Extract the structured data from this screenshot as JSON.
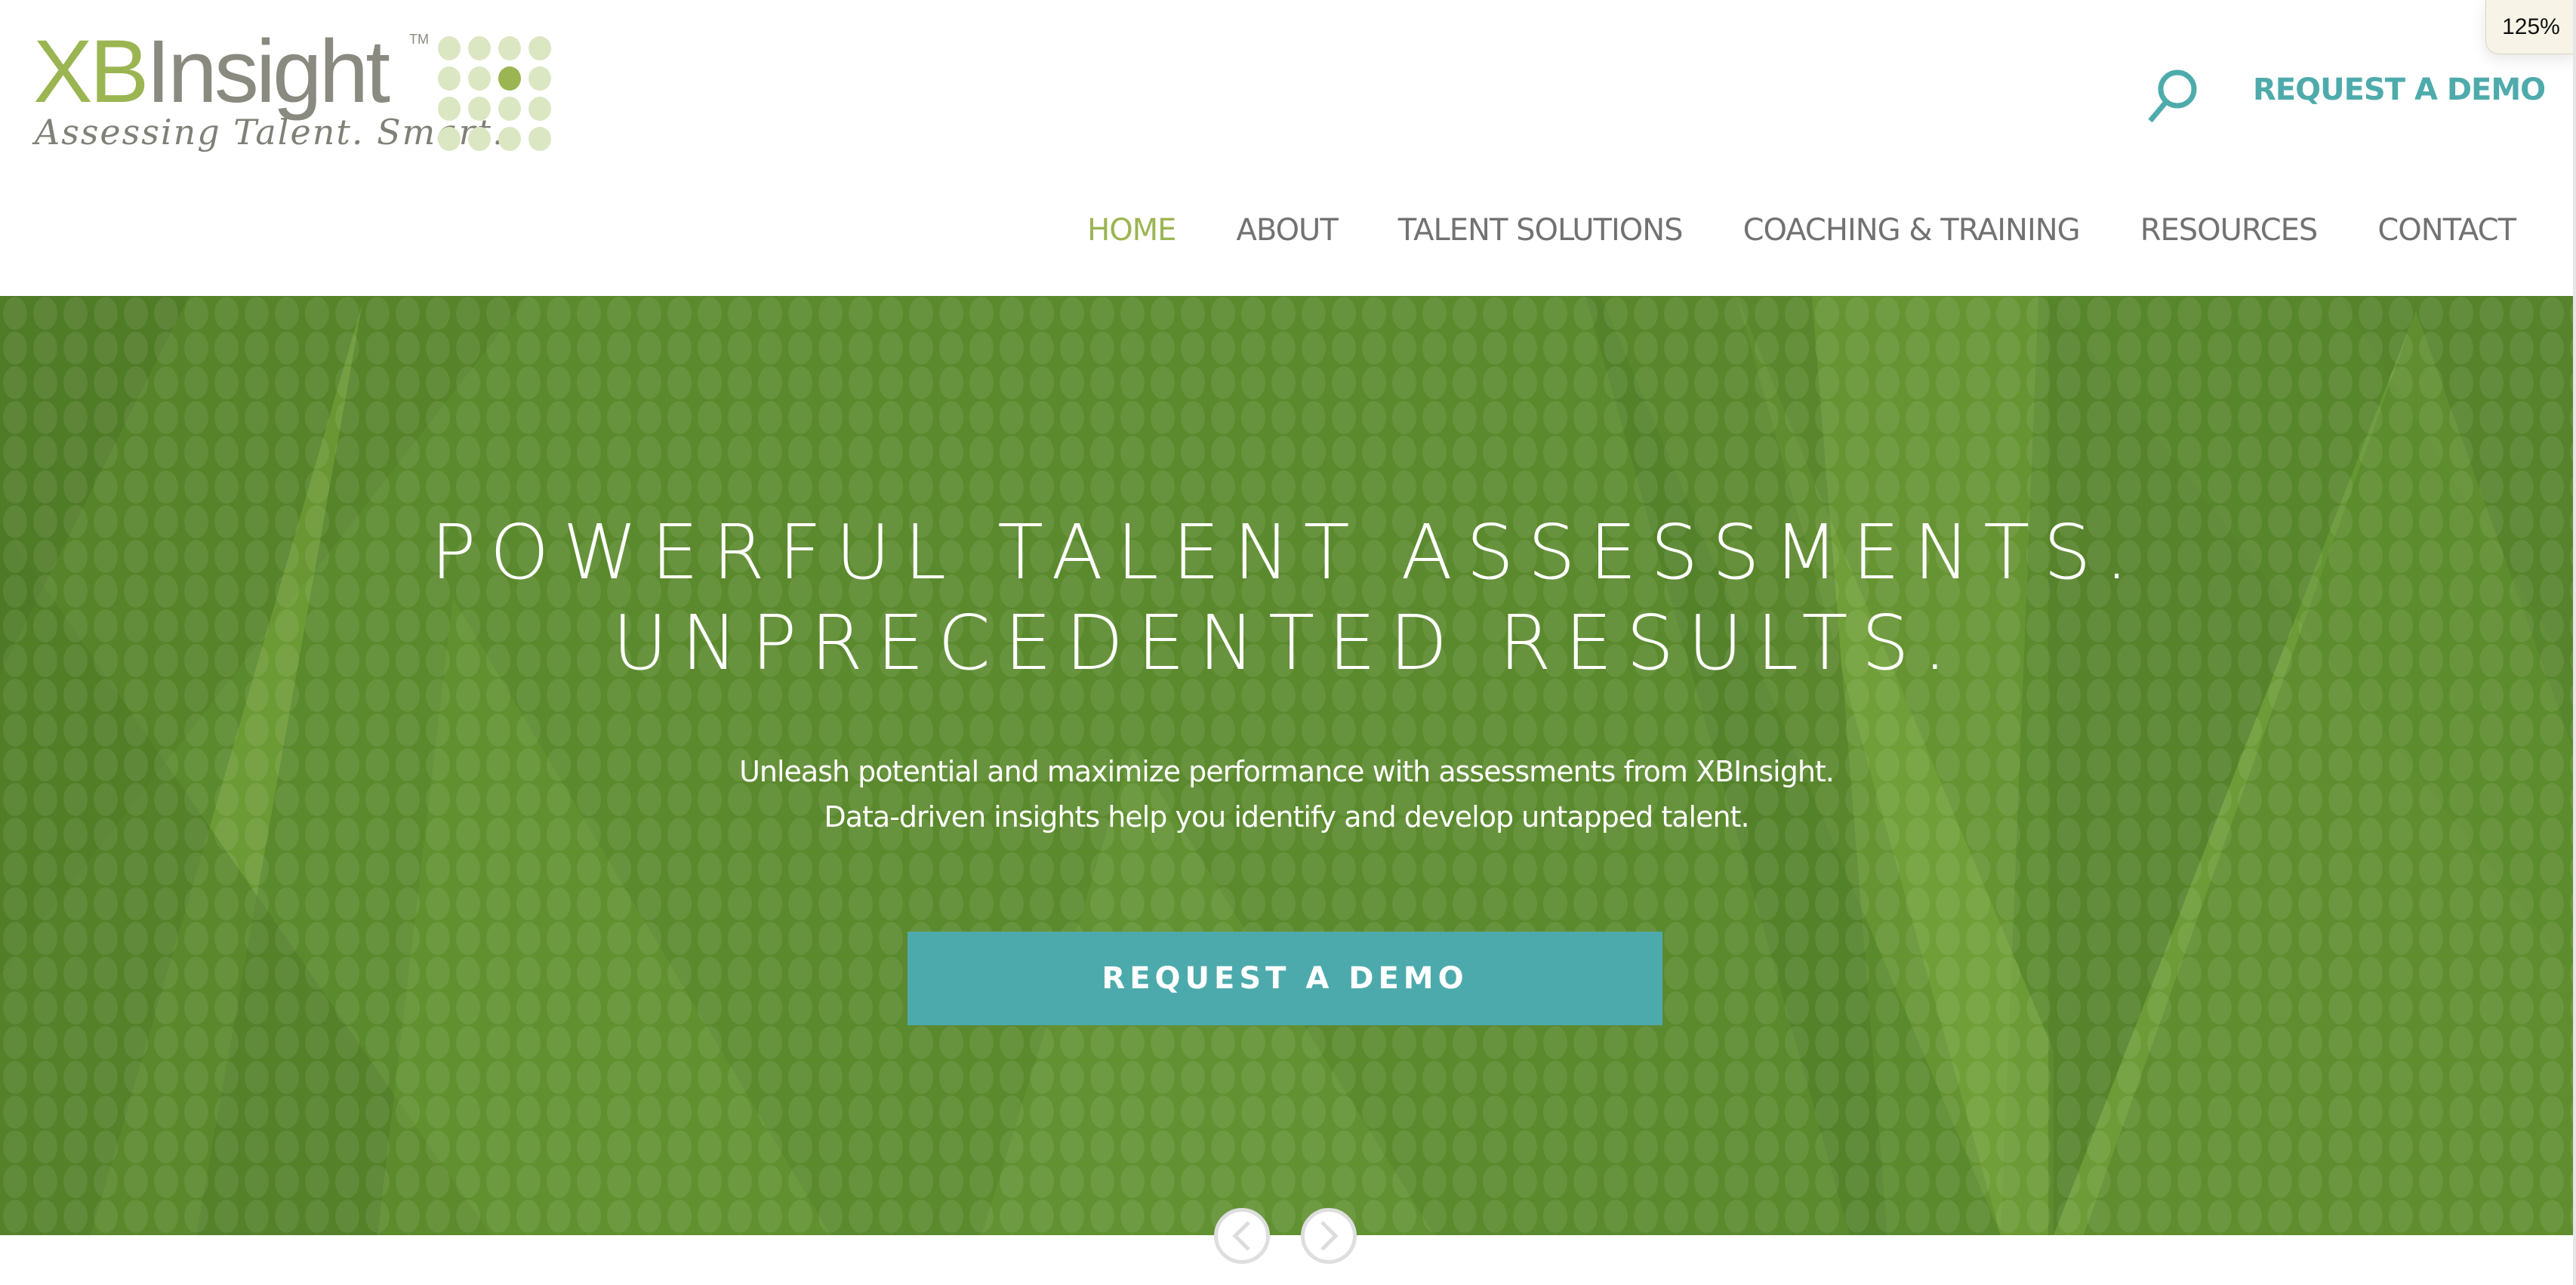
{
  "browser": {
    "zoom_level": "125%"
  },
  "header": {
    "logo": {
      "brand_part1": "XB",
      "brand_part2": "Insight",
      "trademark": "TM",
      "tagline": "Assessing Talent. Smart."
    },
    "search_icon": "search-icon",
    "request_demo_label": "REQUEST A DEMO"
  },
  "nav": {
    "items": [
      {
        "label": "HOME",
        "active": true
      },
      {
        "label": "ABOUT",
        "active": false
      },
      {
        "label": "TALENT SOLUTIONS",
        "active": false
      },
      {
        "label": "COACHING & TRAINING",
        "active": false
      },
      {
        "label": "RESOURCES",
        "active": false
      },
      {
        "label": "CONTACT",
        "active": false
      }
    ]
  },
  "hero": {
    "headline_line1": "POWERFUL TALENT ASSESSMENTS.",
    "headline_line2": "UNPRECEDENTED RESULTS.",
    "subtext_line1": "Unleash potential and maximize performance with assessments from XBInsight.",
    "subtext_line2": "Data-driven insights help you identify and develop untapped talent.",
    "cta_label": "REQUEST A DEMO",
    "prev_icon": "chevron-left-icon",
    "next_icon": "chevron-right-icon"
  },
  "colors": {
    "brand_green": "#9bb552",
    "brand_gray": "#8a8a80",
    "accent_teal": "#4daaac",
    "hero_green": "#5c8a2f",
    "nav_text": "#727272"
  }
}
